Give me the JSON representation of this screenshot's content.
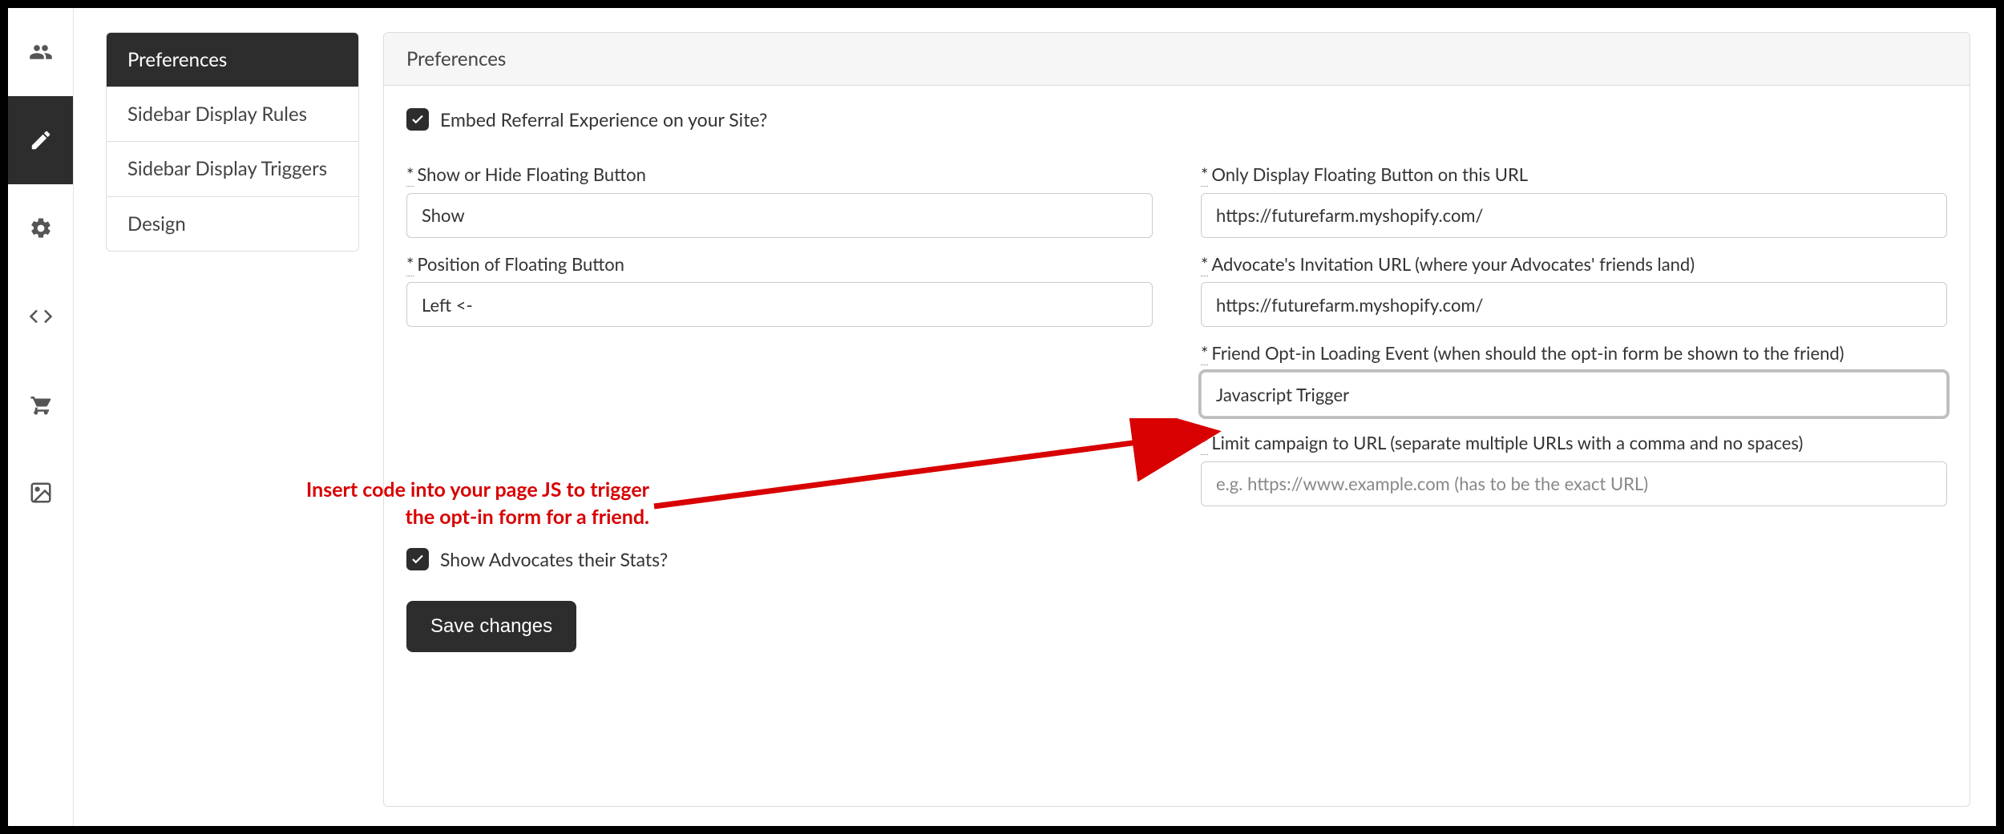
{
  "rail": [
    {
      "name": "users-icon",
      "active": false
    },
    {
      "name": "edit-icon",
      "active": true
    },
    {
      "name": "cogs-icon",
      "active": false
    },
    {
      "name": "code-icon",
      "active": false
    },
    {
      "name": "cart-icon",
      "active": false
    },
    {
      "name": "image-icon",
      "active": false
    }
  ],
  "sidenav": {
    "items": [
      {
        "label": "Preferences",
        "active": true
      },
      {
        "label": "Sidebar Display Rules",
        "active": false
      },
      {
        "label": "Sidebar Display Triggers",
        "active": false
      },
      {
        "label": "Design",
        "active": false
      }
    ]
  },
  "panel": {
    "title": "Preferences",
    "embed_label": "Embed Referral Experience on your Site?",
    "left": {
      "show_label": "Show or Hide Floating Button",
      "show_value": "Show",
      "pos_label": "Position of Floating Button",
      "pos_value": "Left <-"
    },
    "right": {
      "url_label": "Only Display Floating Button on this URL",
      "url_value": "https://futurefarm.myshopify.com/",
      "inv_label": "Advocate's Invitation URL (where your Advocates' friends land)",
      "inv_value": "https://futurefarm.myshopify.com/",
      "event_label": "Friend Opt-in Loading Event (when should the opt-in form be shown to the friend)",
      "event_value": "Javascript Trigger",
      "limit_label": "Limit campaign to URL (separate multiple URLs with a comma and no spaces)",
      "limit_placeholder": "e.g. https://www.example.com (has to be the exact URL)"
    },
    "stats_label": "Show Advocates their Stats?",
    "save_label": "Save changes"
  },
  "annotation": {
    "line1": "Insert code into your page JS to trigger",
    "line2": "the opt-in form for a friend."
  }
}
